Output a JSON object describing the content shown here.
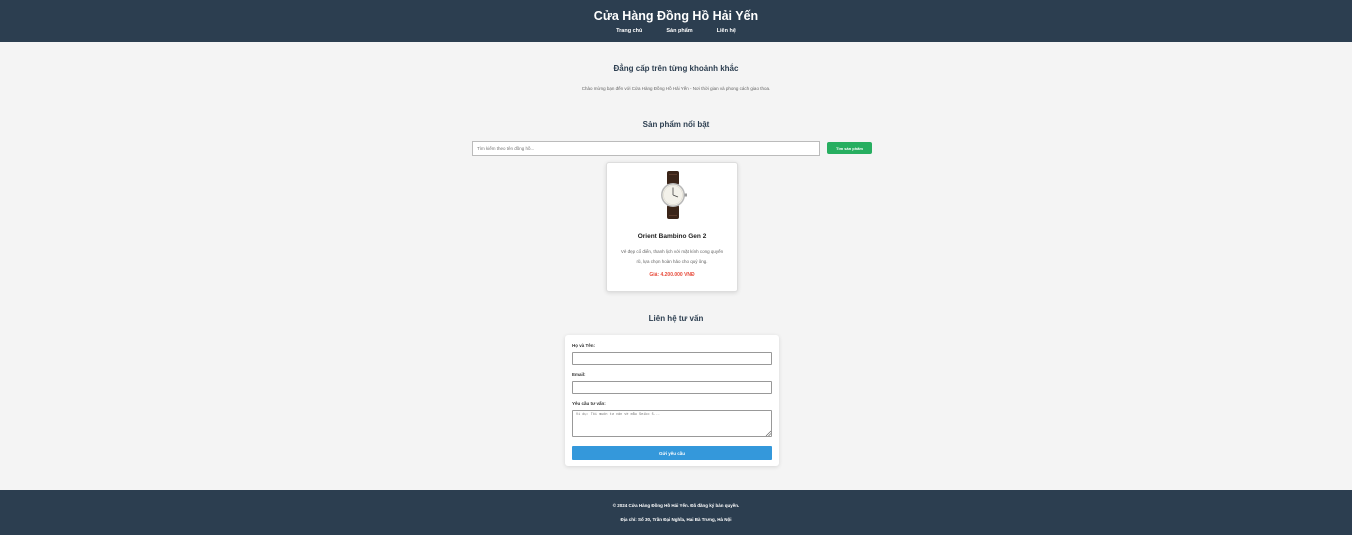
{
  "header": {
    "title": "Cửa Hàng Đồng Hồ Hải Yến",
    "nav": [
      "Trang chủ",
      "Sản phẩm",
      "Liên hệ"
    ]
  },
  "hero": {
    "title": "Đẳng cấp trên từng khoảnh khắc",
    "subtitle": "Chào mừng bạn đến với Cửa Hàng Đồng Hồ Hải Yến - Nơi thời gian và phong cách giao thoa."
  },
  "products": {
    "section_title": "Sản phẩm nổi bật",
    "search_placeholder": "Tìm kiếm theo tên đồng hồ...",
    "search_button": "Tìm sản phẩm",
    "items": [
      {
        "name": "Orient Bambino Gen 2",
        "description": "Vẻ đẹp cổ điển, thanh lịch với mặt kính cong quyến rũ, lựa chọn hoàn hảo cho quý ông.",
        "price": "Giá: 4.200.000 VNĐ",
        "image": "watch-image"
      }
    ]
  },
  "contact": {
    "section_title": "Liên hệ tư vấn",
    "name_label": "Họ và Tên:",
    "email_label": "Email:",
    "request_label": "Yêu cầu tư vấn:",
    "request_placeholder": "Ví dụ: Tôi muốn tư vấn về mẫu Seiko 5...",
    "submit": "Gửi yêu cầu"
  },
  "footer": {
    "copyright": "© 2024 Cửa Hàng Đồng Hồ Hải Yến. Đã đăng ký bản quyền.",
    "address": "Địa chỉ: Số 30, Trần Đại Nghĩa, Hai Bà Trưng, Hà Nội"
  },
  "colors": {
    "header_bg": "#2c3e50",
    "search_button": "#27ae60",
    "submit_button": "#3498db",
    "price": "#e74c3c"
  }
}
